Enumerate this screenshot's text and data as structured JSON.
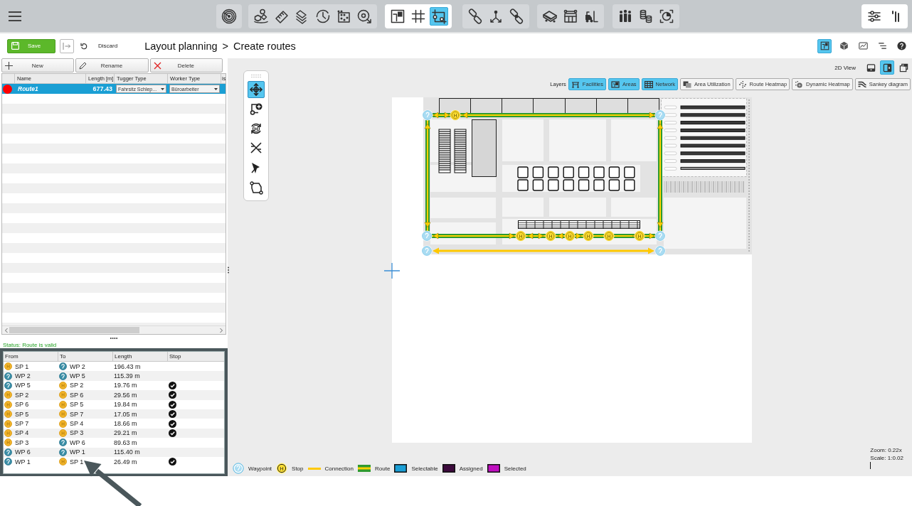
{
  "top_toolbar": {
    "groups": [
      {
        "active": false,
        "tools": [
          {
            "selected": false
          }
        ]
      },
      {
        "active": false,
        "tools": [
          {
            "selected": false
          },
          {
            "selected": false
          },
          {
            "selected": false
          },
          {
            "selected": false
          },
          {
            "selected": false
          },
          {
            "selected": false
          }
        ]
      },
      {
        "active": true,
        "tools": [
          {
            "selected": false
          },
          {
            "selected": false
          },
          {
            "selected": true
          }
        ]
      },
      {
        "active": false,
        "tools": [
          {
            "selected": false
          },
          {
            "selected": false
          },
          {
            "selected": false
          }
        ]
      },
      {
        "active": false,
        "tools": [
          {
            "selected": false
          },
          {
            "selected": false
          },
          {
            "selected": false
          }
        ]
      },
      {
        "active": false,
        "tools": [
          {
            "selected": false
          },
          {
            "selected": false
          },
          {
            "selected": false
          }
        ]
      },
      {
        "active": true,
        "tools": [
          {
            "selected": false
          },
          {
            "selected": false
          }
        ]
      }
    ]
  },
  "header": {
    "save_label": "Save",
    "discard_label": "Discard",
    "breadcrumb": [
      "Layout planning",
      "Create routes"
    ],
    "separator": ">",
    "view_tools": [
      {
        "selected": true
      },
      {
        "selected": false
      },
      {
        "selected": false
      },
      {
        "selected": false
      },
      {
        "selected": false
      }
    ]
  },
  "routes_panel": {
    "buttons": [
      {
        "kind": "add",
        "label": "New"
      },
      {
        "kind": "rename",
        "label": "Rename"
      },
      {
        "kind": "delete",
        "label": "Delete"
      }
    ],
    "columns": [
      "Name",
      "Length [m]",
      "Tugger Type",
      "Worker Type",
      "is"
    ],
    "rows": [
      {
        "color": "#ff0000",
        "name": "Route1",
        "length": "677.43",
        "tugger_type": "Fahrsitz Schlep...",
        "worker_type": "Büroarbeiter",
        "selected": true
      }
    ],
    "status": "Status: Route is valid"
  },
  "segments": {
    "columns": [
      "From",
      "To",
      "Length",
      "Stop"
    ],
    "rows": [
      {
        "from": {
          "kind": "stop",
          "badge": "H",
          "label": "SP 1"
        },
        "to": {
          "kind": "waypoint",
          "label": "WP 2"
        },
        "length": "196.43 m",
        "stop": false
      },
      {
        "from": {
          "kind": "waypoint",
          "label": "WP 2"
        },
        "to": {
          "kind": "waypoint",
          "label": "WP 5"
        },
        "length": "115.39 m",
        "stop": false
      },
      {
        "from": {
          "kind": "waypoint",
          "label": "WP 5"
        },
        "to": {
          "kind": "stop",
          "badge": "H",
          "label": "SP 2"
        },
        "length": "19.76 m",
        "stop": true
      },
      {
        "from": {
          "kind": "stop",
          "badge": "H",
          "label": "SP 2"
        },
        "to": {
          "kind": "stop",
          "badge": "H",
          "label": "SP 6"
        },
        "length": "29.56 m",
        "stop": true
      },
      {
        "from": {
          "kind": "stop",
          "badge": "H",
          "label": "SP 6"
        },
        "to": {
          "kind": "stop",
          "badge": "H",
          "label": "SP 5"
        },
        "length": "19.84 m",
        "stop": true
      },
      {
        "from": {
          "kind": "stop",
          "badge": "H",
          "label": "SP 5"
        },
        "to": {
          "kind": "stop",
          "badge": "H",
          "label": "SP 7"
        },
        "length": "17.05 m",
        "stop": true
      },
      {
        "from": {
          "kind": "stop",
          "badge": "H",
          "label": "SP 7"
        },
        "to": {
          "kind": "stop",
          "badge": "H",
          "label": "SP 4"
        },
        "length": "18.66 m",
        "stop": true
      },
      {
        "from": {
          "kind": "stop",
          "badge": "H",
          "label": "SP 4"
        },
        "to": {
          "kind": "stop",
          "badge": "H",
          "label": "SP 3"
        },
        "length": "29.21 m",
        "stop": true
      },
      {
        "from": {
          "kind": "stop",
          "badge": "H",
          "label": "SP 3"
        },
        "to": {
          "kind": "waypoint",
          "label": "WP 6"
        },
        "length": "89.63 m",
        "stop": false
      },
      {
        "from": {
          "kind": "waypoint",
          "label": "WP 6"
        },
        "to": {
          "kind": "waypoint",
          "label": "WP 1"
        },
        "length": "115.40 m",
        "stop": false
      },
      {
        "from": {
          "kind": "waypoint",
          "label": "WP 1"
        },
        "to": {
          "kind": "stop",
          "badge": "H",
          "label": "SP 1"
        },
        "length": "26.49 m",
        "stop": true
      }
    ]
  },
  "map_view": {
    "view_label": "2D View",
    "view_modes": [
      {
        "selected": false
      },
      {
        "selected": true
      },
      {
        "selected": false
      }
    ],
    "layers_label": "Layers",
    "layers": [
      {
        "label": "Facilities",
        "on": true
      },
      {
        "label": "Areas",
        "on": true
      },
      {
        "label": "Network",
        "on": true
      },
      {
        "label": "Area Utilization",
        "on": false
      },
      {
        "label": "Route Heatmap",
        "on": false
      },
      {
        "label": "Dynamic Heatmap",
        "on": false
      },
      {
        "label": "Sankey diagram",
        "on": false
      }
    ],
    "tools": [
      {
        "selected": true
      },
      {
        "selected": false
      },
      {
        "selected": false,
        "badge": "H"
      },
      {
        "selected": false
      },
      {
        "selected": false
      },
      {
        "selected": false
      }
    ],
    "markers": [
      {
        "kind": "waypoint"
      },
      {
        "kind": "stop",
        "badge": "H"
      },
      {
        "kind": "waypoint"
      },
      {
        "kind": "waypoint"
      },
      {
        "kind": "stop",
        "badge": "H"
      },
      {
        "kind": "stop",
        "badge": "H"
      },
      {
        "kind": "stop",
        "badge": "H"
      },
      {
        "kind": "stop",
        "badge": "H"
      },
      {
        "kind": "stop",
        "badge": "H"
      },
      {
        "kind": "stop",
        "badge": "H"
      },
      {
        "kind": "waypoint"
      },
      {
        "kind": "waypoint"
      },
      {
        "kind": "waypoint"
      }
    ],
    "legend": [
      {
        "kind": "waypoint",
        "label": "Waypoint"
      },
      {
        "kind": "stop",
        "badge": "H",
        "label": "Stop"
      },
      {
        "kind": "connection",
        "label": "Connection"
      },
      {
        "kind": "route",
        "label": "Route"
      },
      {
        "kind": "swatch",
        "color": "#1b9fd6",
        "label": "Selectable"
      },
      {
        "kind": "swatch",
        "color": "#3d0a3d",
        "label": "Assigned"
      },
      {
        "kind": "swatch",
        "color": "#c010c0",
        "label": "Selected"
      }
    ],
    "zoom": "Zoom: 0.22x",
    "scale": "Scale: 1:0.02"
  }
}
